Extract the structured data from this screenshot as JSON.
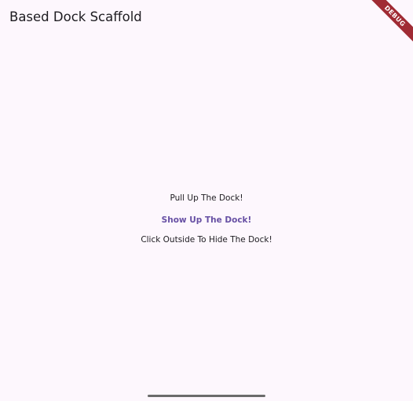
{
  "app_bar": {
    "title": "Based Dock Scaffold"
  },
  "debug_banner": {
    "label": "DEBUG",
    "color": "#a02b34"
  },
  "content": {
    "pull_text": "Pull Up The Dock!",
    "show_button_label": "Show Up The Dock!",
    "hide_text": "Click Outside To Hide The Dock!"
  },
  "colors": {
    "background": "#fdf7fd",
    "accent": "#6750a4",
    "text": "#1d1b20"
  }
}
